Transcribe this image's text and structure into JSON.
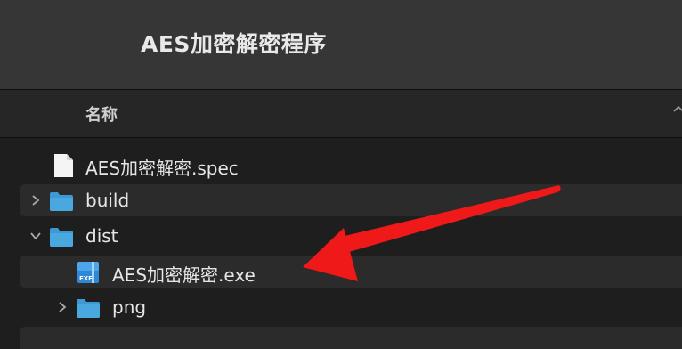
{
  "window": {
    "title": "AES加密解密程序"
  },
  "columns": {
    "name_label": "名称"
  },
  "files": [
    {
      "name": "AES加密解密.spec",
      "type": "document",
      "icon": "document-icon"
    },
    {
      "name": "build",
      "type": "folder",
      "icon": "folder-icon",
      "expanded": false
    },
    {
      "name": "dist",
      "type": "folder",
      "icon": "folder-icon",
      "expanded": true
    },
    {
      "name": "AES加密解密.exe",
      "type": "executable",
      "icon": "exe-icon",
      "icon_label": "EXE"
    },
    {
      "name": "png",
      "type": "folder",
      "icon": "folder-icon",
      "expanded": false
    }
  ],
  "colors": {
    "folder": "#4aa8e0",
    "annotation_arrow": "#f01919",
    "background": "#1e1e1e",
    "titlebar": "#363636"
  }
}
